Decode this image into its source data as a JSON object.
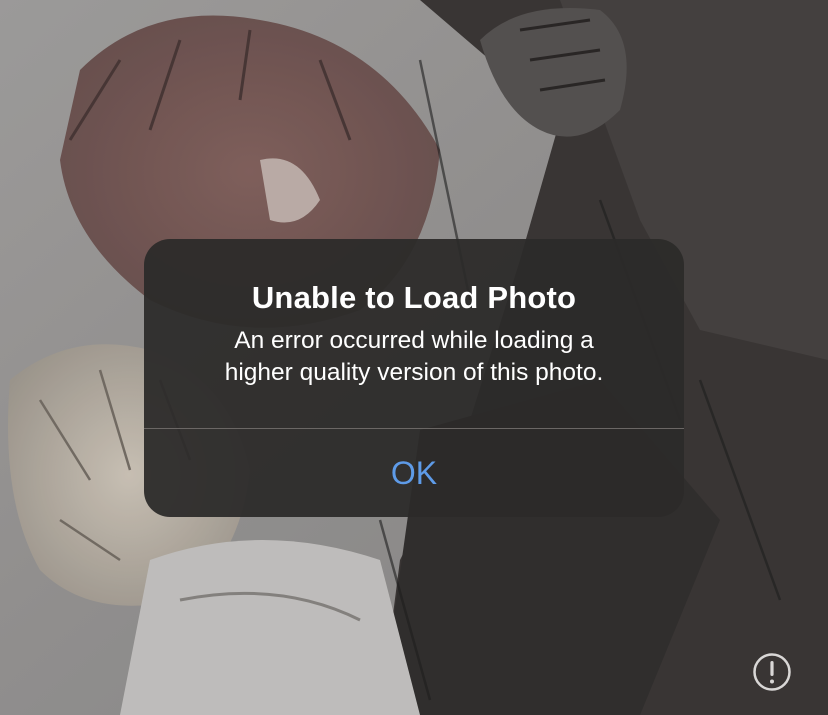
{
  "alert": {
    "title": "Unable to Load Photo",
    "message_line1": "An error occurred while loading a",
    "message_line2": "higher quality version of this photo.",
    "ok_label": "OK"
  },
  "icons": {
    "info": "exclamation-circle-icon"
  },
  "colors": {
    "alert_background": "#2c2a29",
    "ok_accent": "#5e9be8",
    "title_text": "#ffffff"
  }
}
